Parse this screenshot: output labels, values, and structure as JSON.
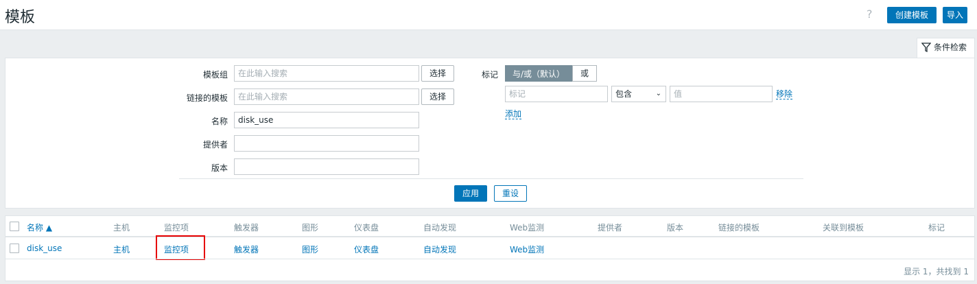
{
  "header": {
    "title": "模板",
    "help_icon": "?",
    "create_button": "创建模板",
    "import_button": "导入"
  },
  "filter_tab": {
    "label": "条件检索",
    "icon": "filter-icon"
  },
  "filter": {
    "template_group_label": "模板组",
    "template_group_placeholder": "在此输入搜索",
    "linked_templates_label": "链接的模板",
    "linked_templates_placeholder": "在此输入搜索",
    "select_button": "选择",
    "name_label": "名称",
    "name_value": "disk_use",
    "vendor_label": "提供者",
    "vendor_value": "",
    "version_label": "版本",
    "version_value": "",
    "tags_label": "标记",
    "tag_and_or": "与/或（默认）",
    "tag_or": "或",
    "tag_placeholder": "标记",
    "tag_operator": "包含",
    "tag_value_placeholder": "值",
    "remove_link": "移除",
    "add_link": "添加",
    "apply_button": "应用",
    "reset_button": "重设"
  },
  "table": {
    "columns": [
      "名称 ▲",
      "主机",
      "监控项",
      "触发器",
      "图形",
      "仪表盘",
      "自动发现",
      "Web监测",
      "提供者",
      "版本",
      "链接的模板",
      "关联到模板",
      "标记"
    ],
    "rows": [
      {
        "name": "disk_use",
        "hosts": "主机",
        "items": "监控项",
        "triggers": "触发器",
        "graphs": "图形",
        "dashboards": "仪表盘",
        "discovery": "自动发现",
        "web": "Web监测"
      }
    ],
    "footer": "显示 1，共找到 1"
  }
}
